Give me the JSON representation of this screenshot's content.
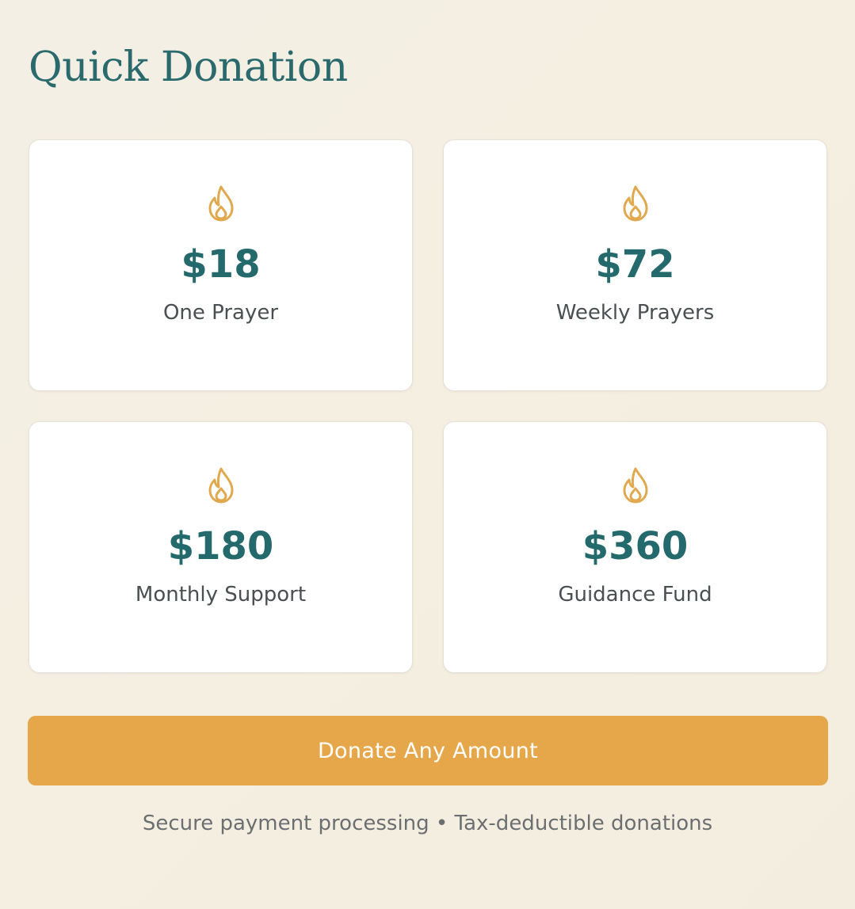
{
  "page": {
    "title": "Quick Donation"
  },
  "options": [
    {
      "amount": "$18",
      "label": "One Prayer",
      "icon": "flame-icon"
    },
    {
      "amount": "$72",
      "label": "Weekly Prayers",
      "icon": "flame-icon"
    },
    {
      "amount": "$180",
      "label": "Monthly Support",
      "icon": "flame-icon"
    },
    {
      "amount": "$360",
      "label": "Guidance Fund",
      "icon": "flame-icon"
    }
  ],
  "donate_button": {
    "label": "Donate Any Amount"
  },
  "footer": {
    "text": "Secure payment processing • Tax-deductible donations"
  },
  "colors": {
    "accent": "#e6a74a",
    "primary": "#246a6d",
    "background": "#f4efe4",
    "card": "#ffffff"
  }
}
